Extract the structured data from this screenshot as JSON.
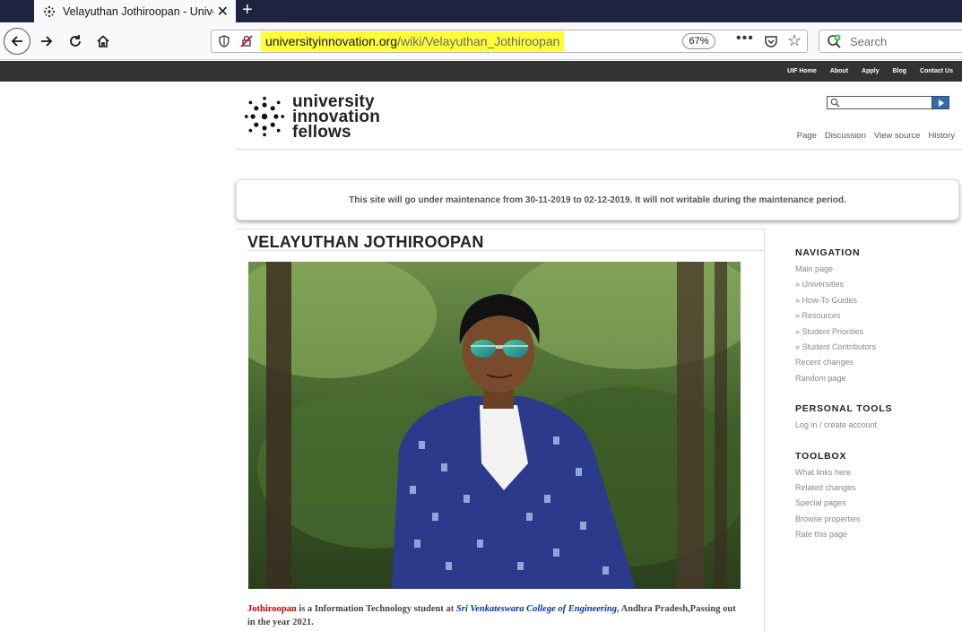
{
  "browser": {
    "tab_title": "Velayuthan Jothiroopan - Unive",
    "url_host": "universityinnovation.org",
    "url_path": "/wiki/Velayuthan_Jothiroopan",
    "zoom": "67%",
    "search_placeholder": "Search"
  },
  "site": {
    "top_links": [
      "UIF Home",
      "About",
      "Apply",
      "Blog",
      "Contact Us"
    ],
    "logo_lines": [
      "university",
      "innovation",
      "fellows"
    ],
    "page_actions": [
      "Page",
      "Discussion",
      "View source",
      "History"
    ],
    "banner": "This site will go under maintenance from 30-11-2019 to 02-12-2019. It will not writable during the maintenance period."
  },
  "article": {
    "title": "VELAYUTHAN JOTHIROOPAN",
    "bio_name": "Jothiroopan",
    "bio_part1": " is a Information Technology student at ",
    "bio_college": "Sri Venkateswara College of Engineering",
    "bio_part2": ", Andhra Pradesh,Passing out in the year 2021."
  },
  "sidebar": {
    "navigation_heading": "NAVIGATION",
    "navigation_items": [
      "Main page",
      "» Universities",
      "» How-To Guides",
      "» Resources",
      "» Student Priorities",
      "» Student Contributors",
      "Recent changes",
      "Random page"
    ],
    "personal_heading": "PERSONAL TOOLS",
    "personal_items": [
      "Log in / create account"
    ],
    "toolbox_heading": "TOOLBOX",
    "toolbox_items": [
      "What links here",
      "Related changes",
      "Special pages",
      "Browse properties",
      "Rate this page"
    ]
  },
  "colors": {
    "tabstrip": "#202340",
    "sitebar": "#333333",
    "url_highlight": "#fdfd3a",
    "bio_name": "#cc0000",
    "bio_link": "#0033aa"
  }
}
